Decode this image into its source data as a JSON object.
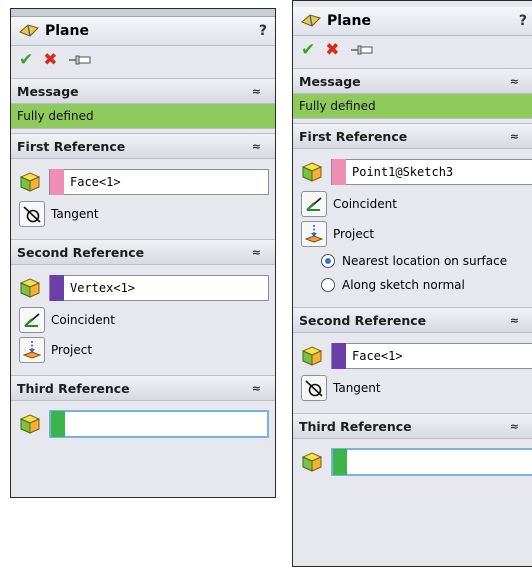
{
  "left": {
    "title": "Plane",
    "help": "?",
    "message": {
      "header": "Message",
      "text": "Fully defined"
    },
    "first_reference": {
      "header": "First Reference",
      "selection": "Face<1>",
      "swatch_color": "#f08fb4",
      "constraints": [
        "Tangent"
      ]
    },
    "second_reference": {
      "header": "Second Reference",
      "selection": "Vertex<1>",
      "swatch_color": "#6b3fa8",
      "constraints": [
        "Coincident",
        "Project"
      ]
    },
    "third_reference": {
      "header": "Third Reference",
      "selection": "",
      "swatch_color": "#3bb54a"
    }
  },
  "right": {
    "title": "Plane",
    "help": "?",
    "message": {
      "header": "Message",
      "text": "Fully defined"
    },
    "first_reference": {
      "header": "First Reference",
      "selection": "Point1@Sketch3",
      "swatch_color": "#f08fb4",
      "constraints": [
        "Coincident",
        "Project"
      ],
      "project_options": [
        "Nearest location on surface",
        "Along sketch normal"
      ],
      "selected_option": "Nearest location on surface"
    },
    "second_reference": {
      "header": "Second Reference",
      "selection": "Face<1>",
      "swatch_color": "#6b3fa8",
      "constraints": [
        "Tangent"
      ]
    },
    "third_reference": {
      "header": "Third Reference",
      "selection": "",
      "swatch_color": "#3bb54a"
    }
  },
  "icons": {
    "ok": "✔",
    "cancel": "✖",
    "collapse": "≈"
  },
  "colors": {
    "message_ok": "#8fcb5c",
    "active_field_border": "#76b3e0"
  }
}
